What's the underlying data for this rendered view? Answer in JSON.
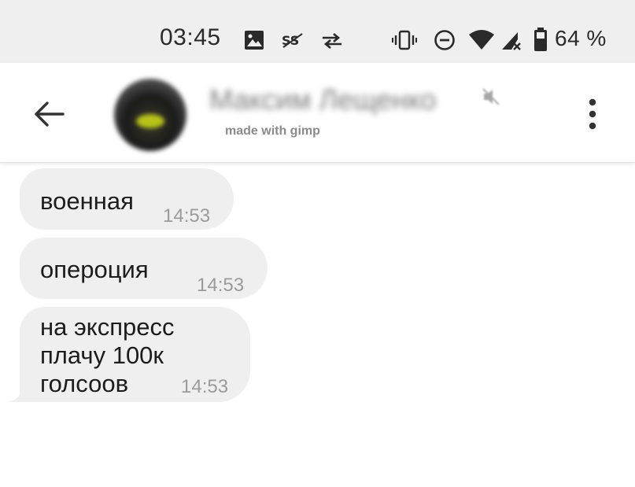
{
  "status_bar": {
    "time": "03:45",
    "battery_percent": "64 %",
    "icons": [
      "image-icon",
      "sync-icon",
      "data-transfer-icon",
      "vibrate-icon",
      "do-not-disturb-icon",
      "wifi-icon",
      "cellular-signal-icon",
      "battery-icon"
    ]
  },
  "header": {
    "back_icon": "arrow-left-icon",
    "contact_name": "Максим Лещенко",
    "contact_status": "made with gimp",
    "muted_icon": "muted-speaker-icon",
    "menu_icon": "more-vertical-icon"
  },
  "messages": [
    {
      "text": "военная",
      "time": "14:53"
    },
    {
      "text": "оперoция",
      "time": "14:53"
    },
    {
      "text": "на экспресс\nплачу 100к\nголсоов",
      "time": "14:53"
    }
  ],
  "colors": {
    "status_bar_bg": "#efefef",
    "bubble_bg": "#efefef",
    "text": "#1c1c1c",
    "timestamp": "#9b9b9b"
  }
}
